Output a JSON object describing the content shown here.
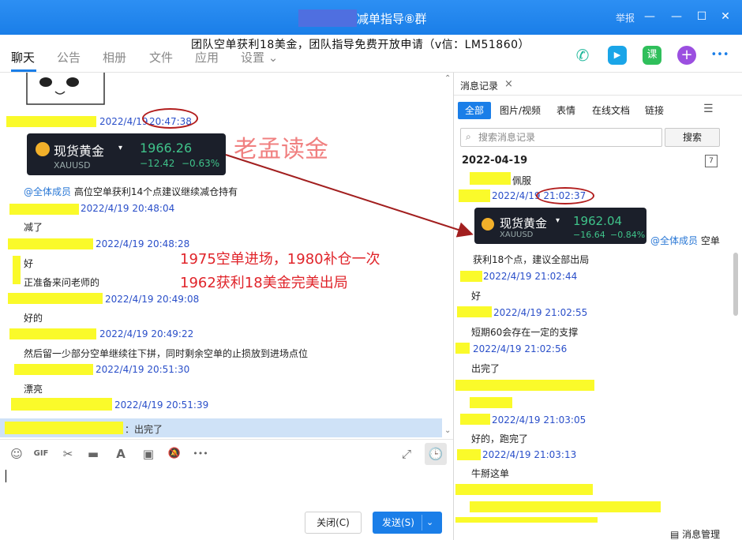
{
  "window": {
    "title": "减单指导⑧群",
    "report_label": "举报",
    "minimize_glyph": "—",
    "maximize_glyph": "☐",
    "close_glyph": "✕",
    "restore_glyph": "❐"
  },
  "nav": {
    "tabs": [
      "聊天",
      "公告",
      "相册",
      "文件",
      "应用",
      "设置 ⌄"
    ],
    "banner": "团队空单获利18美金，团队指导免费开放申请（v信：LM51860）",
    "icons": {
      "phone": "✆",
      "video": "▶",
      "lesson": "课",
      "add": "+",
      "more": "•••"
    }
  },
  "left_chat": {
    "times": [
      "2022/4/19",
      "20:47:38",
      "2022/4/19 20:48:04",
      "2022/4/19 20:48:28",
      "2022/4/19 20:49:08",
      "2022/4/19 20:49:22",
      "2022/4/19 20:51:30",
      "2022/4/19 20:51:39"
    ],
    "card": {
      "name": "现货黄金",
      "caret": "▾",
      "code": "XAUUSD",
      "price": "1966.26",
      "change": "−12.42",
      "change_pct": "−0.63%"
    },
    "mention": "@全体成员",
    "msg_hold": "高位空单获利14个点建议继续减仓持有",
    "msg_reduce": "减了",
    "msg_ok": "好",
    "msg_ask": "正准备来问老师的",
    "msg_good": "好的",
    "msg_rest": "然后留一少部分空单继续往下拼，同时剩余空单的止损放到进场点位",
    "msg_nice": "漂亮",
    "watermark": "老孟读金",
    "annotation_1": "1975空单进场，1980补仓一次",
    "annotation_2": "1962获利18美金完美出局",
    "quote": "：出完了"
  },
  "toolbar": {
    "emoji": "☺",
    "gif": "GIF",
    "scissors": "✂",
    "folder": "▬",
    "font": "A",
    "image": "▣",
    "mute": "🔕",
    "more": "•••",
    "expand": "⤢",
    "history": "🕒"
  },
  "composer": {
    "close_button": "关闭(C)",
    "send_button": "发送(S)",
    "send_drop": "⌄"
  },
  "history": {
    "panel_tab": "消息记录",
    "close_glyph": "×",
    "filter_tabs": [
      "全部",
      "图片/视频",
      "表情",
      "在线文档",
      "链接"
    ],
    "filter_icon": "☰",
    "search_placeholder": "搜索消息记录",
    "search_icon": "⌕",
    "search_button": "搜索",
    "date": "2022-04-19",
    "calendar_glyph": "7",
    "msg_admire": "佩服",
    "time_1": "2022/4/19 21:02:37",
    "card": {
      "name": "现货黄金",
      "caret": "▾",
      "code": "XAUUSD",
      "price": "1962.04",
      "change": "−16.64",
      "change_pct": "−0.84%"
    },
    "mention": "@全体成员",
    "msg_short": "空单",
    "msg_profit": "获利18个点，建议全部出局",
    "time_2": "2022/4/19 21:02:44",
    "msg_ok": "好",
    "time_3": "2022/4/19 21:02:55",
    "msg_support": "短期60会存在一定的支撑",
    "time_4": "2022/4/19 21:02:56",
    "msg_done": "出完了",
    "time_5": "2022/4/19 21:03:05",
    "msg_good_done": "好的，跑完了",
    "time_6": "2022/4/19 21:03:13",
    "msg_bull": "牛掰这单",
    "manage": "消息管理",
    "manage_icon": "▤"
  },
  "colors": {
    "accent": "#1a7ee8",
    "highlight": "#fafa2a",
    "annotation": "#e0242a",
    "gain": "#3fc38a"
  }
}
